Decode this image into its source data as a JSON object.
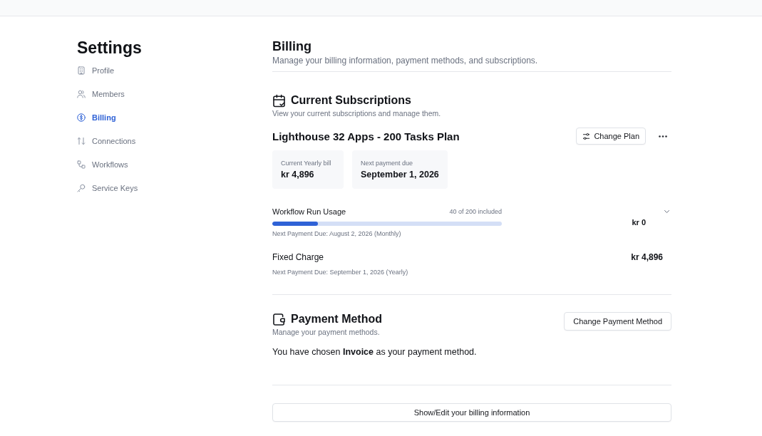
{
  "sidebar": {
    "title": "Settings",
    "items": [
      {
        "label": "Profile",
        "selected": false
      },
      {
        "label": "Members",
        "selected": false
      },
      {
        "label": "Billing",
        "selected": true
      },
      {
        "label": "Connections",
        "selected": false
      },
      {
        "label": "Workflows",
        "selected": false
      },
      {
        "label": "Service Keys",
        "selected": false
      }
    ]
  },
  "page": {
    "title": "Billing",
    "subtitle": "Manage your billing information, payment methods, and subscriptions."
  },
  "subscriptions": {
    "title": "Current Subscriptions",
    "subtitle": "View your current subscriptions and manage them.",
    "plan_name": "Lighthouse 32 Apps - 200 Tasks Plan",
    "change_button": "Change Plan",
    "cards": [
      {
        "label": "Current Yearly bill",
        "value": "kr 4,896"
      },
      {
        "label": "Next payment due",
        "value": "September 1, 2026"
      }
    ],
    "charges": [
      {
        "kind": "usage",
        "name": "Workflow Run Usage",
        "usage": "40 of 200 included",
        "level": 0.2,
        "note": "Next Payment Due: August 2, 2026 (Monthly)",
        "amount": "kr 0",
        "expanded": false
      },
      {
        "kind": "fixed",
        "name": "Fixed Charge",
        "note": "Next Payment Due: September 1, 2026 (Yearly)",
        "amount": "kr 4,896"
      }
    ]
  },
  "payment_method": {
    "title": "Payment Method",
    "subtitle": "Manage your payment methods.",
    "change_button": "Change Payment Method",
    "text": "You have chosen **Invoice** as your payment method."
  },
  "billing_info_button": "Show/Edit your billing information"
}
